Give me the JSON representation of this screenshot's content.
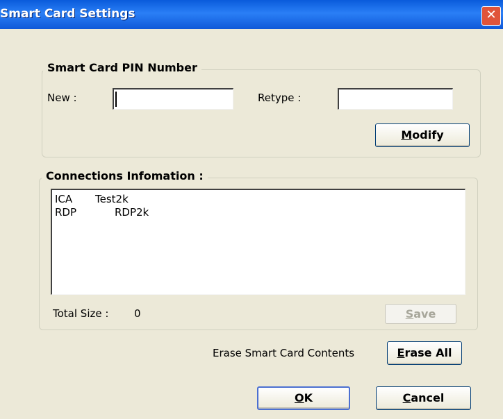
{
  "window": {
    "title": "Smart Card Settings",
    "close_glyph": "✕"
  },
  "pin_group": {
    "legend": "Smart Card PIN Number",
    "new_label": "New :",
    "new_value": "",
    "retype_label": "Retype :",
    "retype_value": "",
    "modify_label_underline": "M",
    "modify_label_rest": "odify"
  },
  "connections_group": {
    "legend": "Connections Infomation :",
    "rows": [
      {
        "type": "ICA",
        "name": "Test2k"
      },
      {
        "type": "RDP",
        "name": "RDP2k"
      }
    ],
    "total_size_label": "Total Size :",
    "total_size_value": "0",
    "save_label_underline": "S",
    "save_label_rest": "ave"
  },
  "erase": {
    "label": "Erase Smart Card Contents",
    "button_underline": "E",
    "button_rest": "rase All"
  },
  "footer": {
    "ok_underline": "O",
    "ok_rest": "K",
    "cancel_underline": "C",
    "cancel_rest": "ancel"
  },
  "colors": {
    "titlebar": "#0a5bdb",
    "dialog_bg": "#ece9d8",
    "close_button": "#e0543a",
    "button_border": "#003c74"
  }
}
